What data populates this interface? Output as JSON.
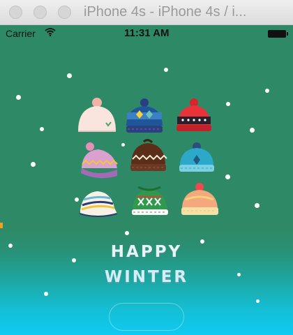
{
  "window": {
    "title": "iPhone 4s - iPhone 4s / i..."
  },
  "status_bar": {
    "carrier": "Carrier",
    "time": "11:31 AM"
  },
  "heading": {
    "line1": "HAPPY",
    "line2": "WINTER"
  },
  "colors": {
    "background_top": "#2e8a66",
    "background_bottom": "#0fcaf2",
    "text": "#e6f4f6"
  },
  "hats": [
    {
      "name": "cream-pompom-hat"
    },
    {
      "name": "navy-diamond-hat"
    },
    {
      "name": "red-dotted-hat"
    },
    {
      "name": "pink-zigzag-hat"
    },
    {
      "name": "brown-zigzag-hat"
    },
    {
      "name": "teal-hat"
    },
    {
      "name": "striped-cap"
    },
    {
      "name": "green-cross-hat"
    },
    {
      "name": "peach-hat"
    }
  ]
}
